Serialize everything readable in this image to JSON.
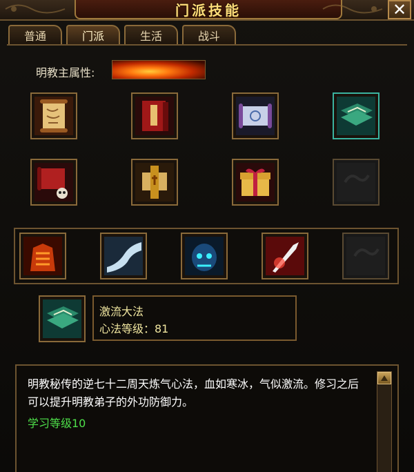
{
  "window": {
    "title": "门派技能",
    "close_label": "✕"
  },
  "tabs": [
    {
      "label": "普通",
      "active": false
    },
    {
      "label": "门派",
      "active": true
    },
    {
      "label": "生活",
      "active": false
    },
    {
      "label": "战斗",
      "active": false
    }
  ],
  "attribute": {
    "label": "明教主属性:",
    "element_icon": "fire-element-icon"
  },
  "skill_slots": [
    {
      "icon": "golden-scroll-icon",
      "empty": false
    },
    {
      "icon": "red-book-icon",
      "empty": false
    },
    {
      "icon": "blue-scroll-icon",
      "empty": false
    },
    {
      "icon": "green-book-icon",
      "empty": false,
      "highlighted": true
    },
    {
      "icon": "red-scroll-skull-icon",
      "empty": false
    },
    {
      "icon": "golden-plaque-scroll-icon",
      "empty": false
    },
    {
      "icon": "gift-box-icon",
      "empty": false
    },
    {
      "icon": "empty-slot-icon",
      "empty": true
    }
  ],
  "combat_slots": [
    {
      "icon": "fire-armor-icon",
      "empty": false
    },
    {
      "icon": "ice-wave-icon",
      "empty": false
    },
    {
      "icon": "demon-skull-icon",
      "empty": false
    },
    {
      "icon": "ice-spear-icon",
      "empty": false
    },
    {
      "icon": "empty-slot-icon",
      "empty": true
    }
  ],
  "selected_skill": {
    "icon": "green-book-icon",
    "name": "激流大法",
    "level_text": "心法等级：81"
  },
  "description": {
    "text": "明教秘传的逆七十二周天炼气心法，血如寒冰，气似激流。修习之后可以提升明教弟子的外功防御力。",
    "requirement": "学习等级10"
  },
  "colors": {
    "gold": "#ffde7a",
    "requirement_green": "#4ee04a",
    "border": "#8a6a3a"
  }
}
